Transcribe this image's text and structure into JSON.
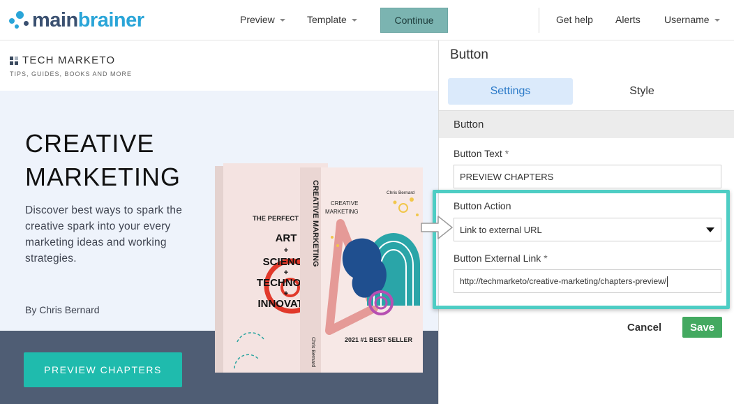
{
  "app": {
    "logo": {
      "part1": "main",
      "part2": "brainer"
    },
    "nav": [
      {
        "label": "Preview",
        "has_caret": true
      },
      {
        "label": "Template",
        "has_caret": true
      }
    ],
    "continue_label": "Continue",
    "right_nav": [
      {
        "label": "Get help"
      },
      {
        "label": "Alerts"
      },
      {
        "label": "Username",
        "has_caret": true
      }
    ]
  },
  "preview": {
    "brand_name": "TECH MARKETO",
    "brand_tagline": "TIPS, GUIDES, BOOKS AND MORE",
    "title_line1": "CREATIVE",
    "title_line2": "MARKETING",
    "description": "Discover best ways to spark the creative spark into your every marketing ideas and working strategies.",
    "author": "By Chris Bernard",
    "button_label": "PREVIEW CHAPTERS",
    "book_back": {
      "heading": "THE PERFECT BLE",
      "lines": [
        "ART",
        "+",
        "SCIENCE",
        "+",
        "TECHNOLO",
        "+",
        "INNOVATIO"
      ]
    },
    "book_front": {
      "spine_title": "CREATIVE MARKETING",
      "spine_author": "Chris Bernard",
      "cover_title_1": "CREATIVE",
      "cover_title_2": "MARKETING",
      "cover_author": "Chris Bernard",
      "badge": "2021 #1 BEST SELLER"
    }
  },
  "panel": {
    "title": "Button",
    "tabs": [
      {
        "label": "Settings",
        "active": true
      },
      {
        "label": "Style",
        "active": false
      }
    ],
    "section": "Button",
    "button_text_label": "Button Text",
    "button_text_value": "PREVIEW CHAPTERS",
    "button_action_label": "Button Action",
    "button_action_value": "Link to external URL",
    "external_link_label": "Button External Link",
    "external_link_value": "http://techmarketo/creative-marketing/chapters-preview/",
    "required_marker": "*",
    "cancel_label": "Cancel",
    "save_label": "Save"
  },
  "colors": {
    "accent_teal": "#1fbbad",
    "highlight": "#4ecdc4",
    "continue_bg": "#7bb4b1",
    "save_green": "#43a960",
    "tab_active_bg": "#dbeafb",
    "tab_active_text": "#2b7ac8",
    "hero_bg": "#eef3fb",
    "hero_bottom": "#4f5d74"
  }
}
